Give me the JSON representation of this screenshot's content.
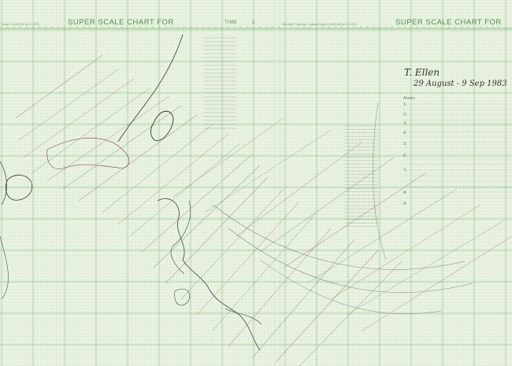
{
  "header": {
    "title_left": "SUPER SCALE CHART FOR",
    "title_right": "SUPER SCALE CHART FOR",
    "time_label": "TIME",
    "time_value": "2",
    "scale_left": "Scale 1:5,000,000 at 22 1/2°N",
    "projection_note": "Mercator Projection - Natural Scale 1:5,000,000 at 22 1/2°N"
  },
  "annotation": {
    "storm_name": "T. Ellen",
    "date_range": "29 August - 9 Sep 1983",
    "notes_heading": "Notes",
    "note_lines": [
      "1.",
      "2.",
      "3.",
      "4.",
      "5.",
      "6.",
      "7.",
      "8.",
      "9."
    ]
  },
  "colors": {
    "paper": "#eef3e6",
    "grid": "#a6d39a",
    "grid_major": "#6fb768",
    "title_green": "#4f8f4a",
    "coastline": "#333333"
  }
}
